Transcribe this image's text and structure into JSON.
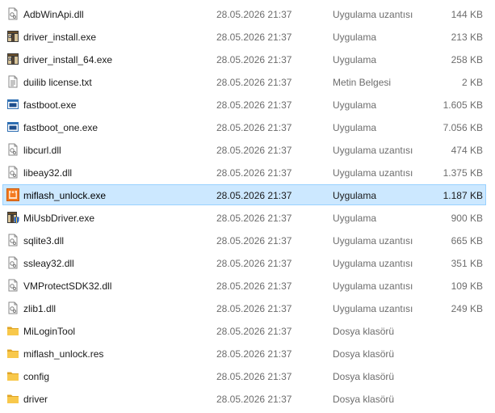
{
  "files": [
    {
      "name": "AdbWinApi.dll",
      "date": "28.05.2026 21:37",
      "type": "Uygulama uzantısı",
      "size": "144 KB",
      "icon": "dll-file-icon",
      "selected": false
    },
    {
      "name": "driver_install.exe",
      "date": "28.05.2026 21:37",
      "type": "Uygulama",
      "size": "213 KB",
      "icon": "installer-exe-icon",
      "selected": false
    },
    {
      "name": "driver_install_64.exe",
      "date": "28.05.2026 21:37",
      "type": "Uygulama",
      "size": "258 KB",
      "icon": "installer-exe-icon",
      "selected": false
    },
    {
      "name": "duilib license.txt",
      "date": "28.05.2026 21:37",
      "type": "Metin Belgesi",
      "size": "2 KB",
      "icon": "text-file-icon",
      "selected": false
    },
    {
      "name": "fastboot.exe",
      "date": "28.05.2026 21:37",
      "type": "Uygulama",
      "size": "1.605 KB",
      "icon": "console-exe-icon",
      "selected": false
    },
    {
      "name": "fastboot_one.exe",
      "date": "28.05.2026 21:37",
      "type": "Uygulama",
      "size": "7.056 KB",
      "icon": "console-exe-icon",
      "selected": false
    },
    {
      "name": "libcurl.dll",
      "date": "28.05.2026 21:37",
      "type": "Uygulama uzantısı",
      "size": "474 KB",
      "icon": "dll-file-icon",
      "selected": false
    },
    {
      "name": "libeay32.dll",
      "date": "28.05.2026 21:37",
      "type": "Uygulama uzantısı",
      "size": "1.375 KB",
      "icon": "dll-file-icon",
      "selected": false
    },
    {
      "name": "miflash_unlock.exe",
      "date": "28.05.2026 21:37",
      "type": "Uygulama",
      "size": "1.187 KB",
      "icon": "miflash-app-icon",
      "selected": true
    },
    {
      "name": "MiUsbDriver.exe",
      "date": "28.05.2026 21:37",
      "type": "Uygulama",
      "size": "900 KB",
      "icon": "installer-shield-exe-icon",
      "selected": false
    },
    {
      "name": "sqlite3.dll",
      "date": "28.05.2026 21:37",
      "type": "Uygulama uzantısı",
      "size": "665 KB",
      "icon": "dll-file-icon",
      "selected": false
    },
    {
      "name": "ssleay32.dll",
      "date": "28.05.2026 21:37",
      "type": "Uygulama uzantısı",
      "size": "351 KB",
      "icon": "dll-file-icon",
      "selected": false
    },
    {
      "name": "VMProtectSDK32.dll",
      "date": "28.05.2026 21:37",
      "type": "Uygulama uzantısı",
      "size": "109 KB",
      "icon": "dll-file-icon",
      "selected": false
    },
    {
      "name": "zlib1.dll",
      "date": "28.05.2026 21:37",
      "type": "Uygulama uzantısı",
      "size": "249 KB",
      "icon": "dll-file-icon",
      "selected": false
    },
    {
      "name": "MiLoginTool",
      "date": "28.05.2026 21:37",
      "type": "Dosya klasörü",
      "size": "",
      "icon": "folder-icon",
      "selected": false
    },
    {
      "name": "miflash_unlock.res",
      "date": "28.05.2026 21:37",
      "type": "Dosya klasörü",
      "size": "",
      "icon": "folder-icon",
      "selected": false
    },
    {
      "name": "config",
      "date": "28.05.2026 21:37",
      "type": "Dosya klasörü",
      "size": "",
      "icon": "folder-icon",
      "selected": false
    },
    {
      "name": "driver",
      "date": "28.05.2026 21:37",
      "type": "Dosya klasörü",
      "size": "",
      "icon": "folder-icon",
      "selected": false
    }
  ],
  "colors": {
    "selection_bg": "#cce8ff",
    "selection_border": "#99d1ff",
    "folder": "#f8c84b",
    "secondary_text": "#6d6d6d"
  }
}
